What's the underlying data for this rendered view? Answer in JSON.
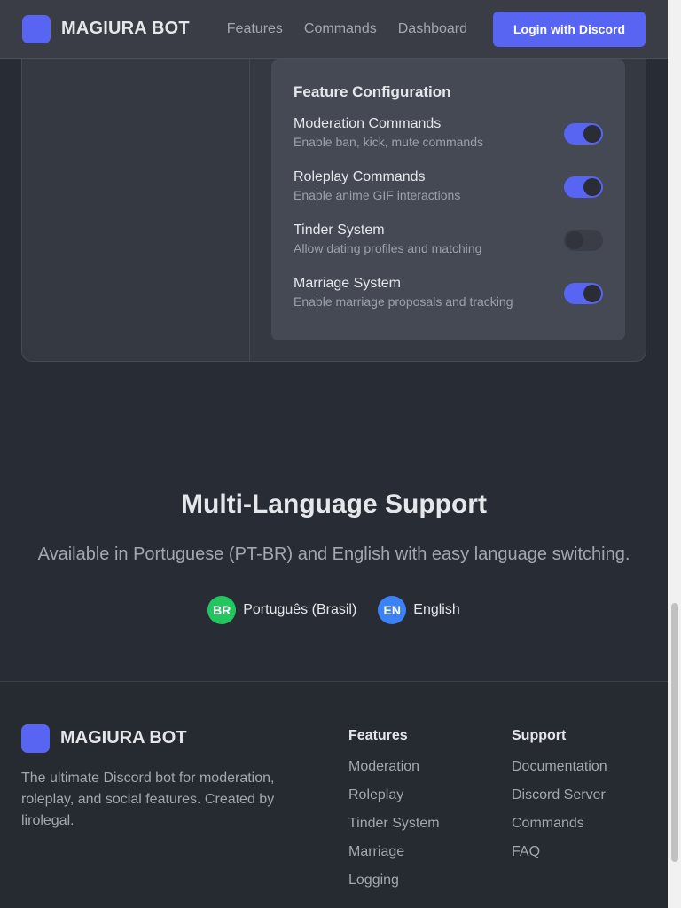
{
  "header": {
    "brand": "MAGIURA BOT",
    "nav": [
      "Features",
      "Commands",
      "Dashboard"
    ],
    "login_label": "Login with Discord"
  },
  "config": {
    "title": "Feature Configuration",
    "features": [
      {
        "name": "Moderation Commands",
        "desc": "Enable ban, kick, mute commands",
        "enabled": true
      },
      {
        "name": "Roleplay Commands",
        "desc": "Enable anime GIF interactions",
        "enabled": true
      },
      {
        "name": "Tinder System",
        "desc": "Allow dating profiles and matching",
        "enabled": false
      },
      {
        "name": "Marriage System",
        "desc": "Enable marriage proposals and tracking",
        "enabled": true
      }
    ]
  },
  "languages": {
    "title": "Multi-Language Support",
    "subtitle": "Available in Portuguese (PT-BR) and English with easy language switching.",
    "options": [
      {
        "code": "BR",
        "name": "Português (Brasil)",
        "color": "#22c55e"
      },
      {
        "code": "EN",
        "name": "English",
        "color": "#3b82f6"
      }
    ]
  },
  "footer": {
    "brand": "MAGIURA BOT",
    "description": "The ultimate Discord bot for moderation, roleplay, and social features. Created by lirolegal.",
    "features_heading": "Features",
    "features_links": [
      "Moderation",
      "Roleplay",
      "Tinder System",
      "Marriage",
      "Logging"
    ],
    "support_heading": "Support",
    "support_links": [
      "Documentation",
      "Discord Server",
      "Commands",
      "FAQ"
    ]
  },
  "colors": {
    "accent": "#5865f2",
    "background": "#282c34"
  }
}
